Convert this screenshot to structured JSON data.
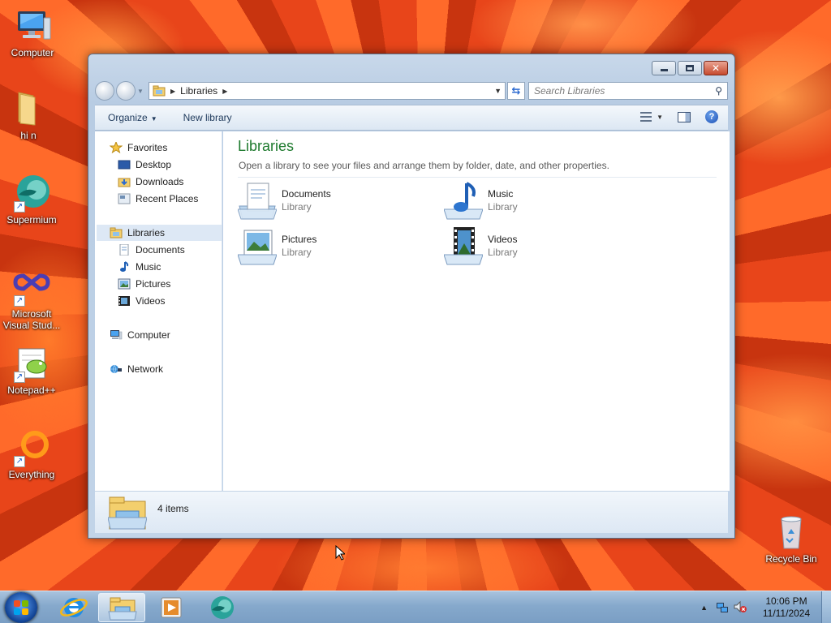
{
  "desktop": {
    "icons": [
      {
        "label": "Computer"
      },
      {
        "label": "hi n"
      },
      {
        "label": "Supermium"
      },
      {
        "label": "Microsoft Visual Stud..."
      },
      {
        "label": "Notepad++"
      },
      {
        "label": "Everything"
      },
      {
        "label": "Recycle Bin"
      }
    ]
  },
  "window": {
    "address": {
      "crumbs": [
        "Libraries"
      ]
    },
    "search": {
      "placeholder": "Search Libraries"
    },
    "toolbar": {
      "organize_label": "Organize",
      "new_library_label": "New library"
    },
    "nav": {
      "favorites": "Favorites",
      "favorites_items": [
        "Desktop",
        "Downloads",
        "Recent Places"
      ],
      "libraries": "Libraries",
      "libraries_items": [
        "Documents",
        "Music",
        "Pictures",
        "Videos"
      ],
      "computer": "Computer",
      "network": "Network"
    },
    "content": {
      "title": "Libraries",
      "subtitle": "Open a library to see your files and arrange them by folder, date, and other properties.",
      "items": [
        {
          "name": "Documents",
          "type": "Library",
          "icon": "documents-library-icon"
        },
        {
          "name": "Music",
          "type": "Library",
          "icon": "music-library-icon"
        },
        {
          "name": "Pictures",
          "type": "Library",
          "icon": "pictures-library-icon"
        },
        {
          "name": "Videos",
          "type": "Library",
          "icon": "videos-library-icon"
        }
      ]
    },
    "details": {
      "count": "4 items"
    }
  },
  "taskbar": {
    "pinned": [
      "internet-explorer-icon",
      "windows-explorer-icon",
      "media-player-icon",
      "supermium-icon"
    ],
    "clock": {
      "time": "10:06 PM",
      "date": "11/11/2024"
    }
  },
  "colors": {
    "library_title": "#1e7a2e",
    "taskbar": "#86a9cc",
    "selection": "#dde8f5"
  }
}
